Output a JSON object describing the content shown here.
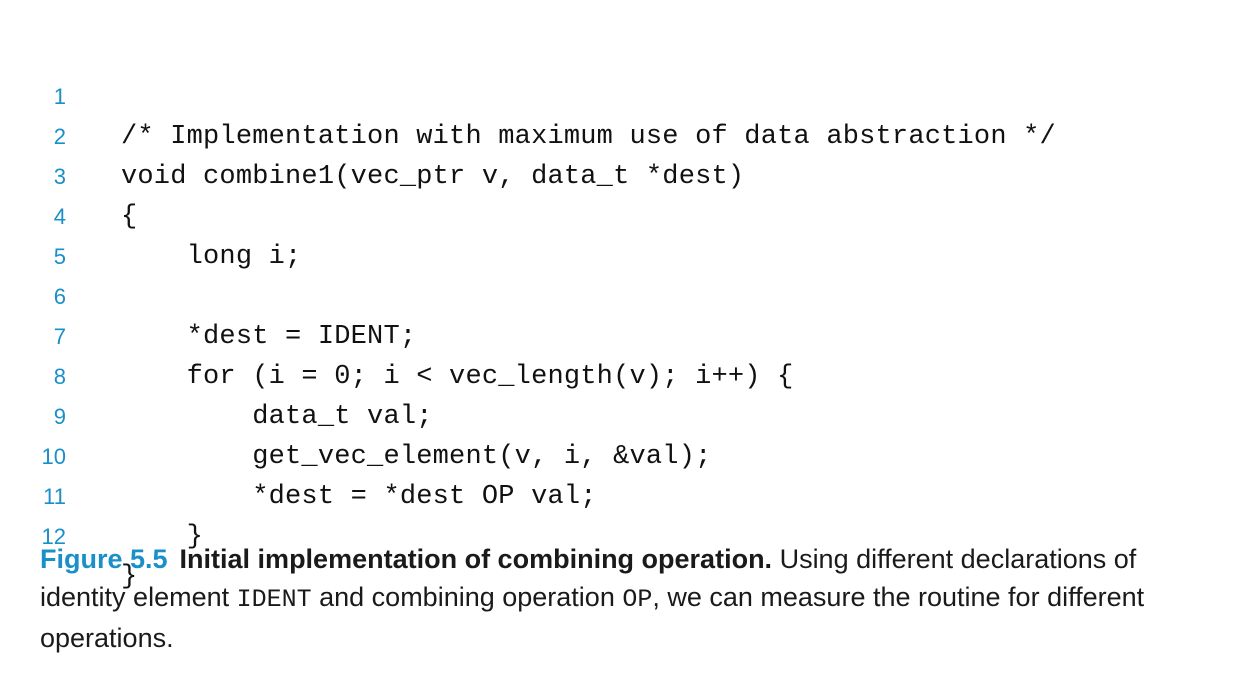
{
  "code": {
    "lines": [
      {
        "number": "1",
        "text": "/* Implementation with maximum use of data abstraction */"
      },
      {
        "number": "2",
        "text": "void combine1(vec_ptr v, data_t *dest)"
      },
      {
        "number": "3",
        "text": "{"
      },
      {
        "number": "4",
        "text": "    long i;"
      },
      {
        "number": "5",
        "text": ""
      },
      {
        "number": "6",
        "text": "    *dest = IDENT;"
      },
      {
        "number": "7",
        "text": "    for (i = 0; i < vec_length(v); i++) {"
      },
      {
        "number": "8",
        "text": "        data_t val;"
      },
      {
        "number": "9",
        "text": "        get_vec_element(v, i, &val);"
      },
      {
        "number": "10",
        "text": "        *dest = *dest OP val;"
      },
      {
        "number": "11",
        "text": "    }"
      },
      {
        "number": "12",
        "text": "}"
      }
    ]
  },
  "caption": {
    "label": "Figure 5.5",
    "title": "Initial implementation of combining operation.",
    "body_1": " Using different declarations of identity element ",
    "ident": "IDENT",
    "body_2": " and combining operation ",
    "op": "OP",
    "body_3": ", we can measure the routine for different operations."
  }
}
